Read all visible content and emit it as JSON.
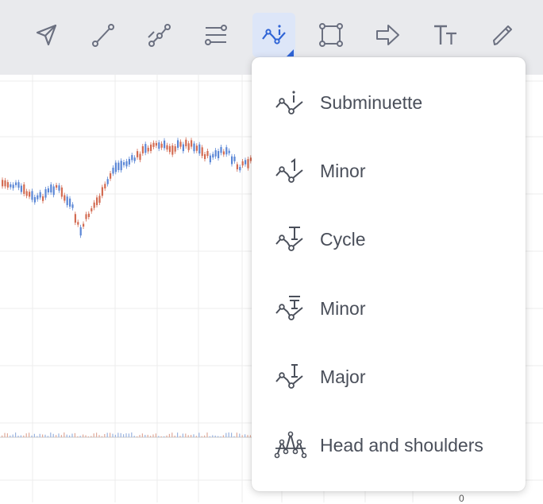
{
  "toolbar": {
    "tools": [
      {
        "icon": "cursor-arrow-icon"
      },
      {
        "icon": "trend-line-icon"
      },
      {
        "icon": "multi-point-line-icon"
      },
      {
        "icon": "fib-levels-icon"
      },
      {
        "icon": "elliott-wave-icon",
        "active": true
      },
      {
        "icon": "rectangle-shape-icon"
      },
      {
        "icon": "arrow-shape-icon"
      },
      {
        "icon": "text-tool-icon"
      },
      {
        "icon": "brush-icon"
      }
    ],
    "active_color": "#2f64d6"
  },
  "chart": {
    "axis_zero_label": "0",
    "up_color": "#5b87d6",
    "down_color": "#d36b52"
  },
  "menu": {
    "items": [
      {
        "label": "Subminuette",
        "icon": "wave-subminuette-icon"
      },
      {
        "label": "Minor",
        "icon": "wave-minor-numeric-icon"
      },
      {
        "label": "Cycle",
        "icon": "wave-cycle-icon"
      },
      {
        "label": "Minor",
        "icon": "wave-minor-icon"
      },
      {
        "label": "Major",
        "icon": "wave-major-icon"
      },
      {
        "label": "Head and shoulders",
        "icon": "head-and-shoulders-icon"
      }
    ]
  }
}
